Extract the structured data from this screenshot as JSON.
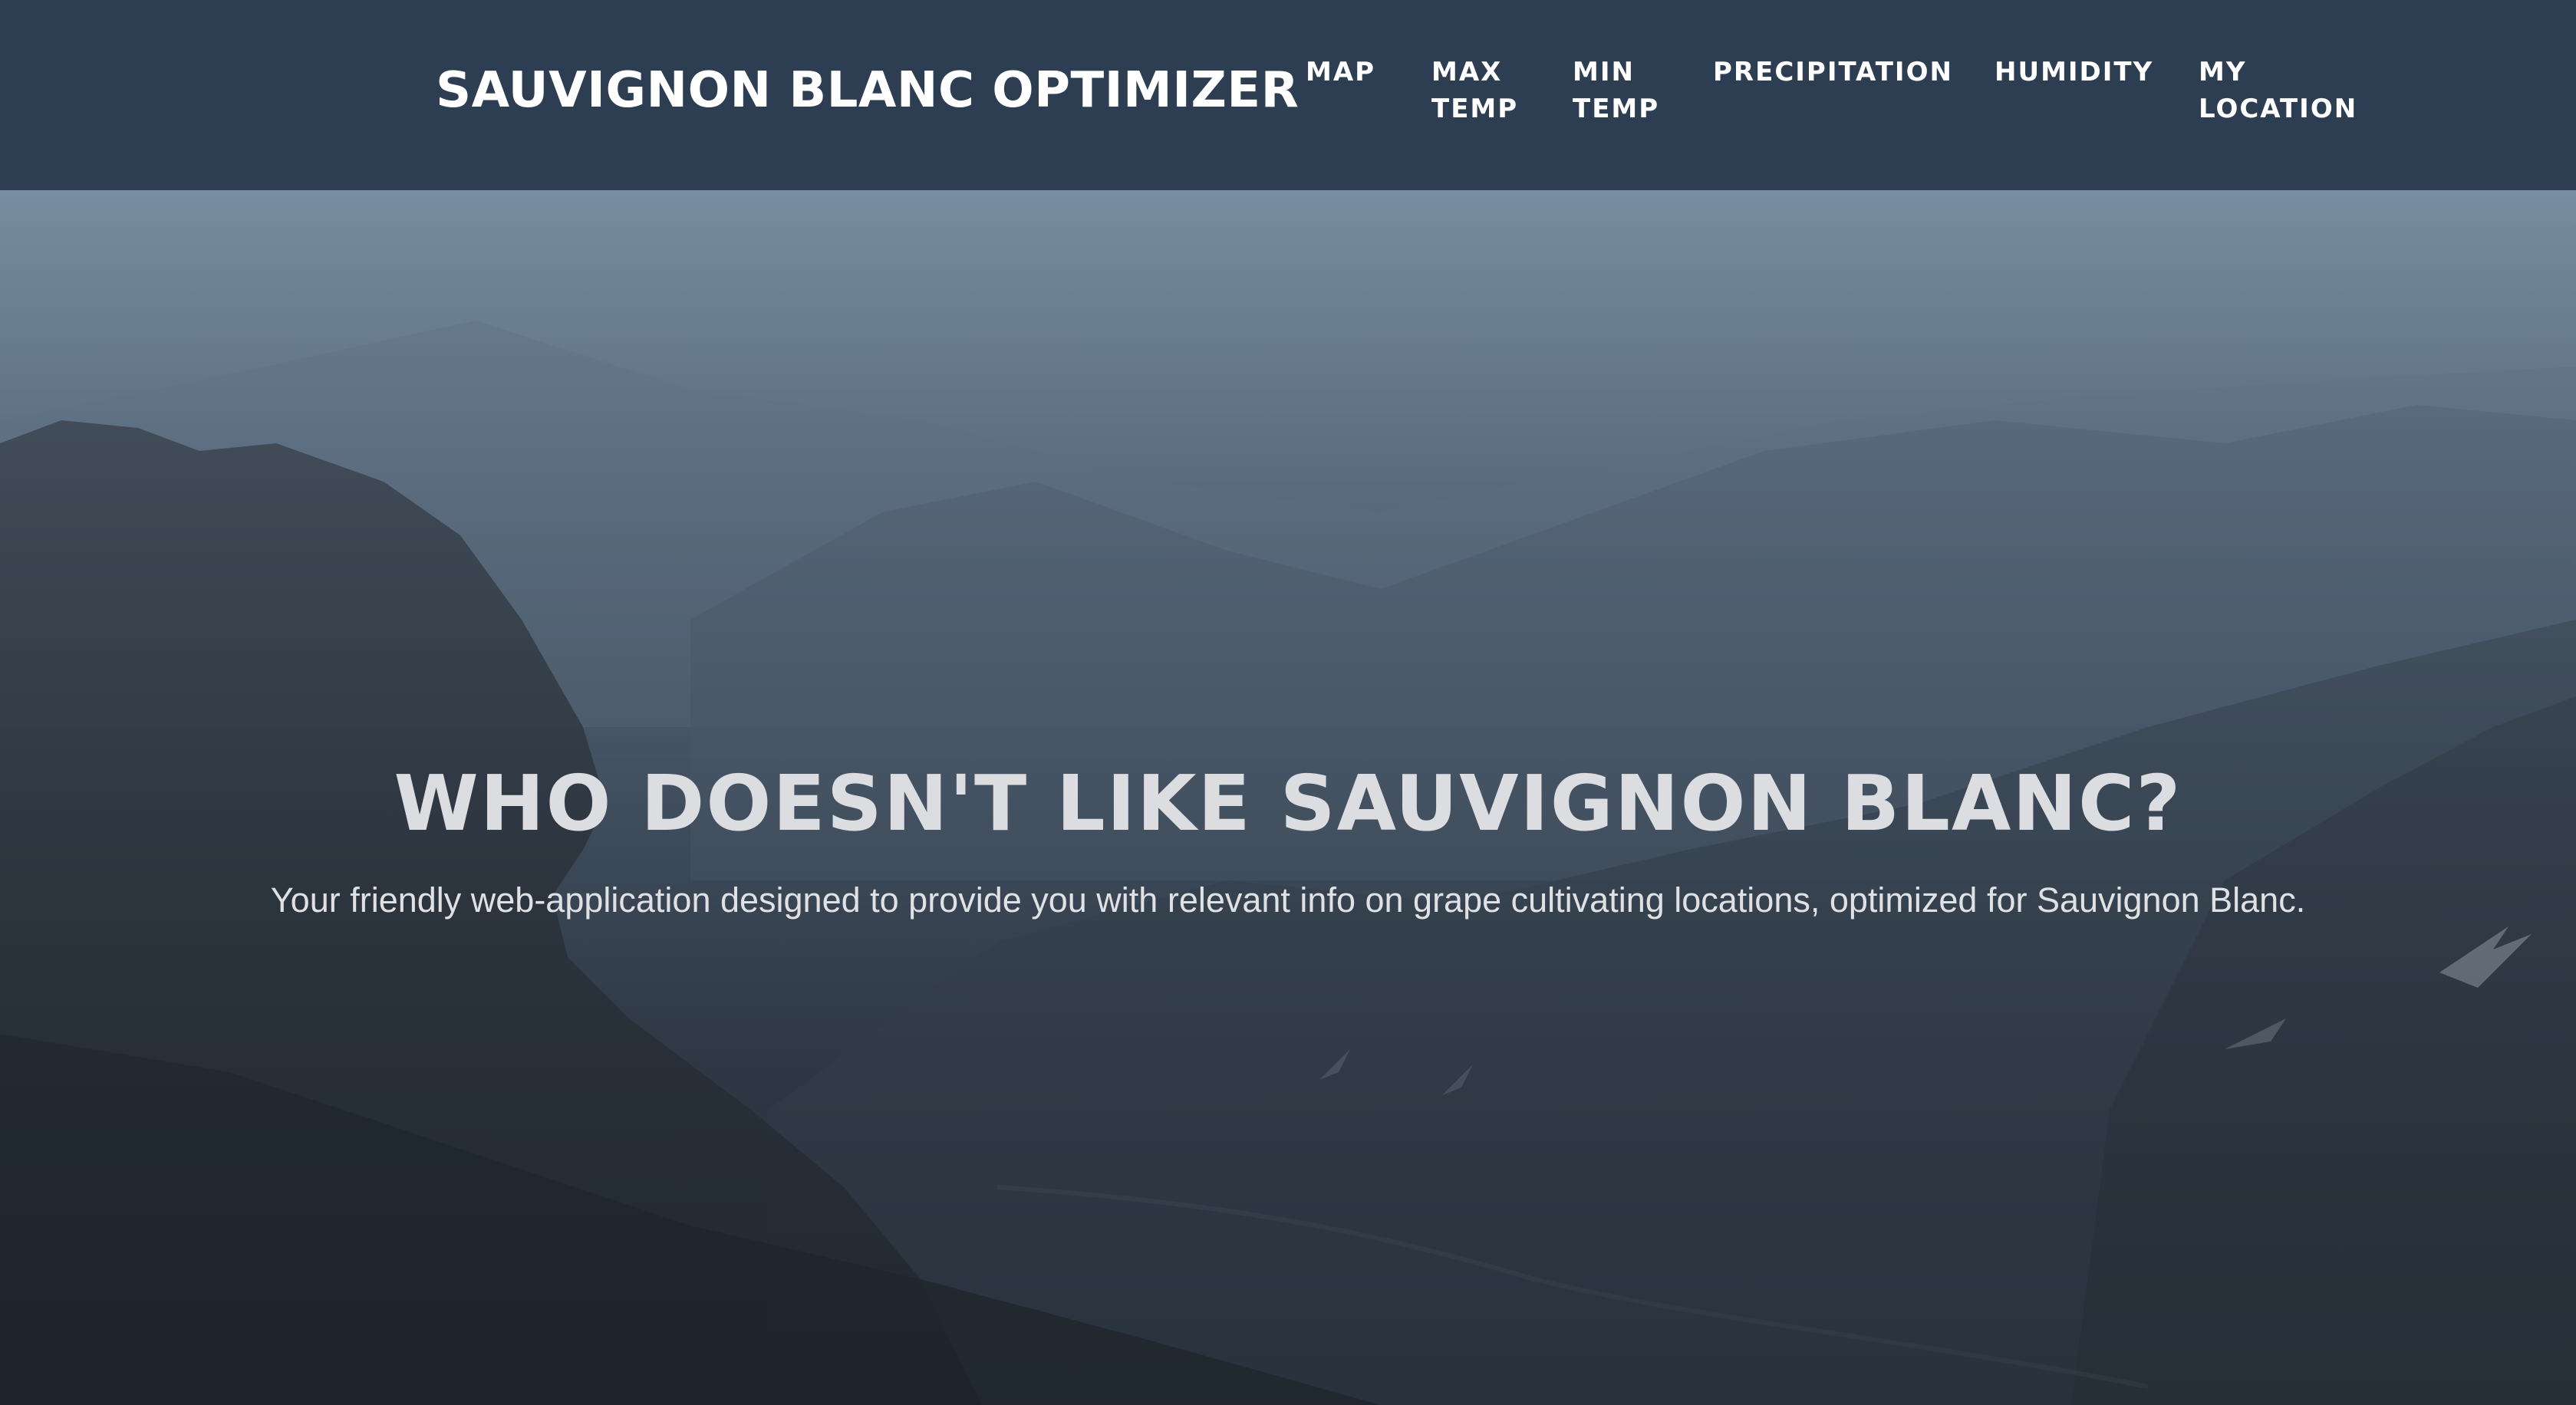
{
  "brand": {
    "title": "SAUVIGNON BLANC OPTIMIZER"
  },
  "nav": {
    "items": [
      {
        "lines": [
          "MAP"
        ]
      },
      {
        "lines": [
          "MAX",
          "TEMP"
        ]
      },
      {
        "lines": [
          "MIN",
          "TEMP"
        ]
      },
      {
        "lines": [
          "PRECIPITATION"
        ]
      },
      {
        "lines": [
          "HUMIDITY"
        ]
      },
      {
        "lines": [
          "MY",
          "LOCATION"
        ]
      }
    ]
  },
  "hero": {
    "title": "WHO DOESN'T LIKE SAUVIGNON BLANC?",
    "subtitle": "Your friendly web-application designed to provide you with relevant info on grape cultivating locations, optimized for Sauvignon Blanc."
  },
  "colors": {
    "navbar_bg": "#2d3e53",
    "nav_text": "#ffffff",
    "hero_title": "#dcdde0",
    "hero_subtitle": "#dfe1e4"
  }
}
